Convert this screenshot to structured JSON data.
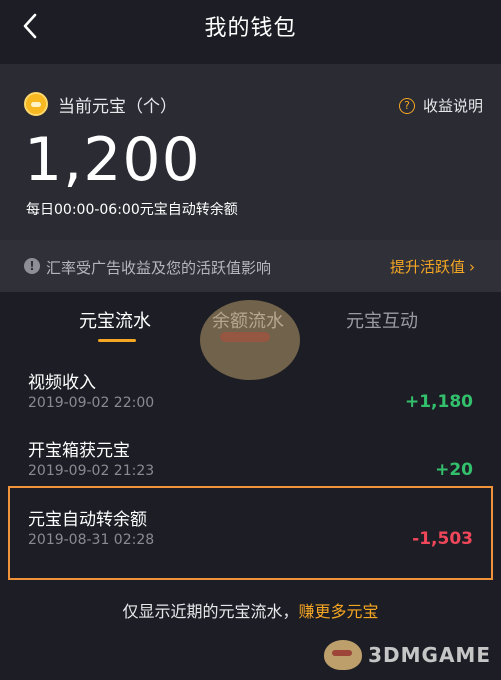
{
  "header": {
    "title": "我的钱包"
  },
  "balance": {
    "label": "当前元宝（个）",
    "help_label": "收益说明",
    "amount": "1,200",
    "note": "每日00:00-06:00元宝自动转余额"
  },
  "notice": {
    "text": "汇率受广告收益及您的活跃值影响",
    "link": "提升活跃值",
    "chevron": "›"
  },
  "tabs": [
    {
      "label": "元宝流水",
      "active": true
    },
    {
      "label": "余额流水",
      "active": false
    },
    {
      "label": "元宝互动",
      "active": false
    }
  ],
  "records": [
    {
      "title": "视频收入",
      "time": "2019-09-02 22:00",
      "amount": "+1,180"
    },
    {
      "title": "开宝箱获元宝",
      "time": "2019-09-02 21:23",
      "amount": "+20"
    },
    {
      "title": "元宝自动转余额",
      "time": "2019-08-31 02:28",
      "amount": "-1,503"
    }
  ],
  "footer": {
    "text": "仅显示近期的元宝流水，",
    "link": "赚更多元宝"
  },
  "watermark": {
    "text": "3DMGAME"
  },
  "colors": {
    "accent": "#f5a623",
    "positive": "#33c06d",
    "negative": "#f0465a",
    "highlight_border": "#f0923a",
    "background": "#1d1e25"
  }
}
